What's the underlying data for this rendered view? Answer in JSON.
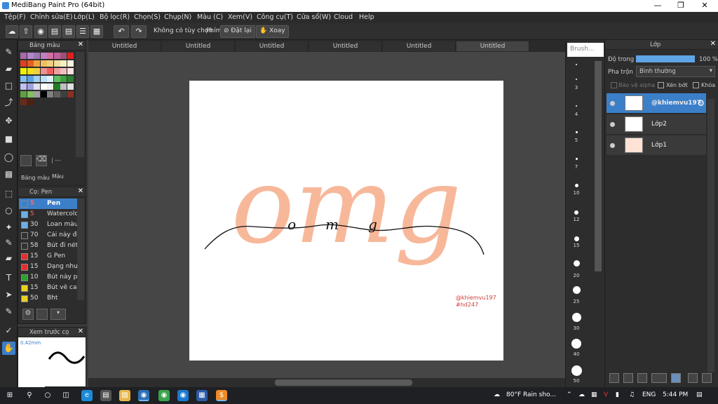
{
  "window": {
    "title": "MediBang Paint Pro (64bit)"
  },
  "menu": [
    "Tệp(F)",
    "Chỉnh sửa(E)",
    "Lớp(L)",
    "Bộ lọc(R)",
    "Chọn(S)",
    "Chụp(N)",
    "Màu (C)",
    "Xem(V)",
    "Công cụ(T)",
    "Cửa sổ(W)",
    "Cloud",
    "Help"
  ],
  "toolbar": {
    "no_options": "Không có tùy chọn",
    "keys_label": "Phím",
    "reset_label": "Đặt lại",
    "rotate_label": "Xoay"
  },
  "color_panel": {
    "title": "Bảng màu",
    "tabs": [
      "Bảng màu",
      "Màu"
    ],
    "bottom_text": "| ---"
  },
  "brush_panel": {
    "title": "Cọ: Pen",
    "items": [
      {
        "size": "5",
        "name": "Pen",
        "color": "#3c7fc9"
      },
      {
        "size": "5",
        "name": "Watercolor",
        "color": "#6ab0e8"
      },
      {
        "size": "30",
        "name": "Loan màu",
        "color": "#6ab0e8"
      },
      {
        "size": "70",
        "name": "Cái này đẹ",
        "color": "#333333"
      },
      {
        "size": "58",
        "name": "Bút đi nét",
        "color": "#333333"
      },
      {
        "size": "15",
        "name": "G Pen",
        "color": "#e03030"
      },
      {
        "size": "15",
        "name": "Dạng như",
        "color": "#e03030"
      },
      {
        "size": "10",
        "name": "Bút này p",
        "color": "#30a030"
      },
      {
        "size": "15",
        "name": "Bút vê ca",
        "color": "#e8d020"
      },
      {
        "size": "50",
        "name": "Bht",
        "color": "#e8d020"
      }
    ]
  },
  "preview_panel": {
    "title": "Xem trước cọ",
    "size": "0.42mm"
  },
  "tabs": [
    "Untitled",
    "Untitled",
    "Untitled",
    "Untitled",
    "Untitled",
    "Untitled"
  ],
  "artwork": {
    "text": "omg",
    "script": "omg",
    "watermark": [
      "@khiemvu197",
      "#hd247"
    ]
  },
  "brush_sizes": {
    "title": "Brush...",
    "labels": [
      "3",
      "4",
      "5",
      "7",
      "10",
      "12",
      "15",
      "20",
      "25",
      "30",
      "40",
      "50"
    ]
  },
  "layer_panel": {
    "title": "Lớp",
    "opacity_label": "Độ trong",
    "opacity_value": "100 %",
    "opacity_fraction": 1.0,
    "blend_label": "Pha trộn",
    "blend_value": "Bình thường",
    "protect_alpha": "Bảo vệ alpha",
    "clipping": "Xén bớt",
    "lock": "Khóa",
    "layers": [
      "@khiemvu197",
      "Lớp2",
      "Lớp1"
    ]
  },
  "taskbar": {
    "weather": "80°F  Rain sho...",
    "lang": "ENG",
    "time": "5:44 PM"
  },
  "colors": {
    "accent": "#3c7fc9",
    "peach": "#f7b89a"
  }
}
